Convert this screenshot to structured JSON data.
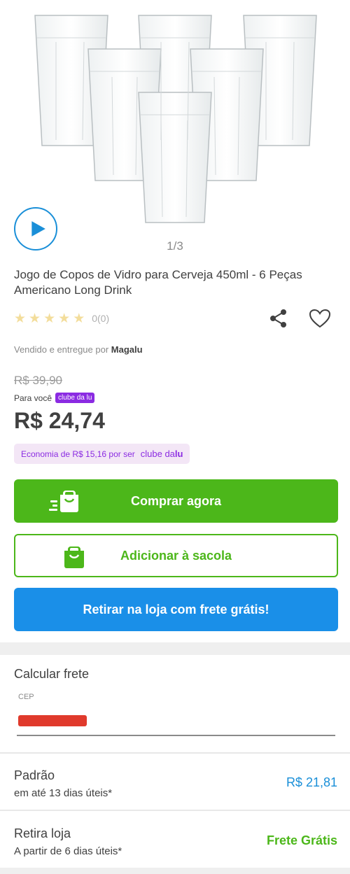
{
  "product": {
    "image_counter": "1/3",
    "title": "Jogo de Copos de Vidro para Cerveja 450ml - 6 Peças Americano Long Drink",
    "rating_count": "0(0)",
    "seller_prefix": "Vendido e entregue por",
    "seller_name": "Magalu"
  },
  "pricing": {
    "old_price": "R$ 39,90",
    "para_voce": "Para você",
    "clube_badge": "clube da lu",
    "price": "R$ 24,74",
    "economy_text": "Economia de R$ 15,16 por ser",
    "clube_prefix": "clube da",
    "clube_suffix": "lu"
  },
  "actions": {
    "buy_now": "Comprar agora",
    "add_to_bag": "Adicionar à sacola",
    "store_pickup": "Retirar na loja com frete grátis!"
  },
  "freight": {
    "title": "Calcular frete",
    "cep_label": "CEP",
    "options": [
      {
        "name": "Padrão",
        "detail": "em até 13 dias úteis*",
        "price": "R$ 21,81"
      },
      {
        "name": "Retira loja",
        "detail": "A partir de 6 dias úteis*",
        "price": "Frete Grátis"
      }
    ]
  },
  "colors": {
    "green": "#4cb71a",
    "blue": "#1a8fe8",
    "purple": "#8b2be2"
  },
  "icons": [
    "play-icon",
    "star-icon",
    "share-icon",
    "heart-icon",
    "fast-bag-icon",
    "bag-icon"
  ]
}
